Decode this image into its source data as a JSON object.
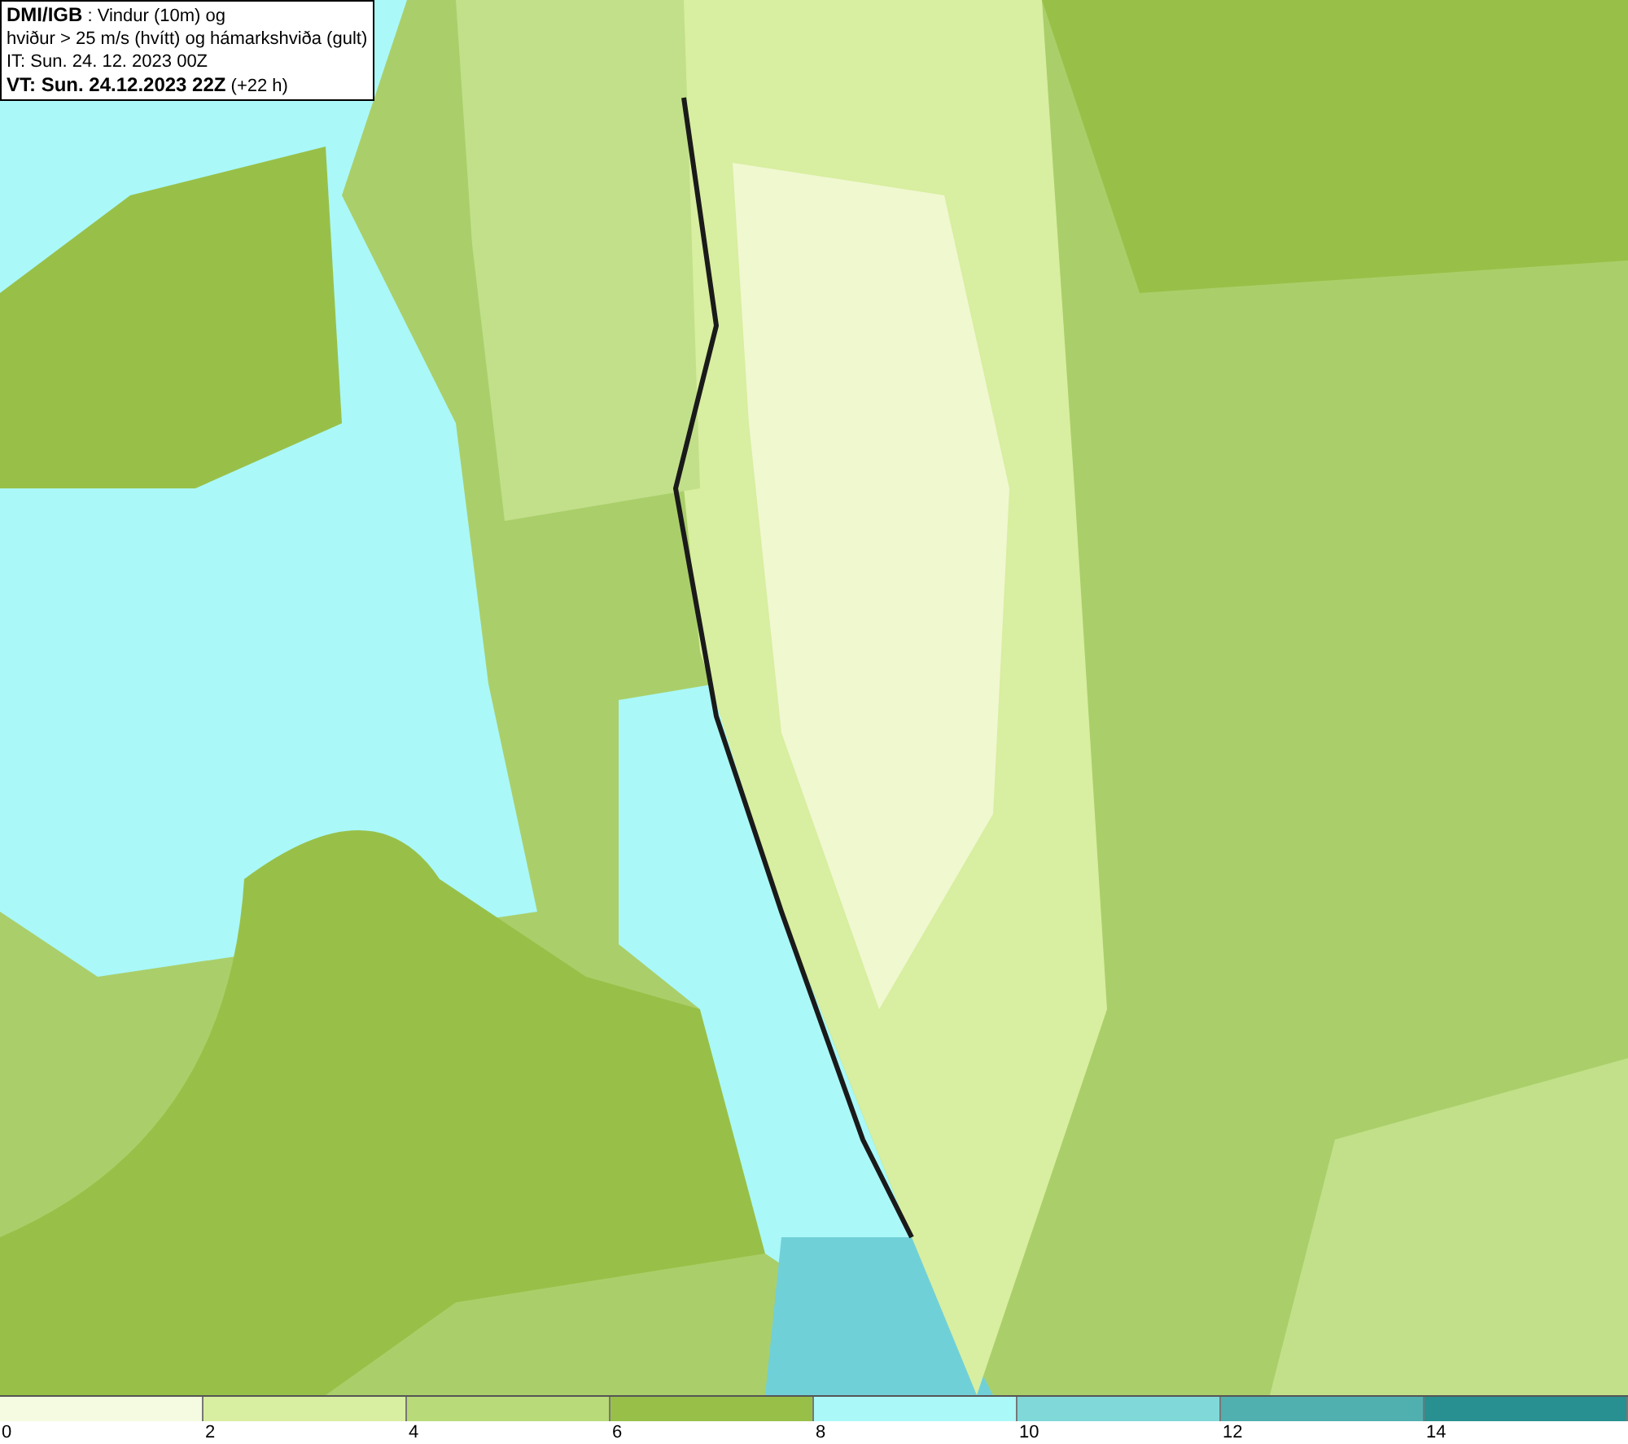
{
  "title_box": {
    "lines": [
      "**DMI/IGB** : Vindur (10m) og",
      "hviður > 25 m/s (hvítt) og hámarkshviða (gult)",
      "IT: Sun. 24. 12. 2023 00Z",
      "**VT: Sun. 24.12.2023 22Z** (+22 h)"
    ]
  },
  "legend": {
    "bins": [
      {
        "label": "0",
        "color": "#f5fbe0"
      },
      {
        "label": "2",
        "color": "#d8eea0"
      },
      {
        "label": "4",
        "color": "#b8da78"
      },
      {
        "label": "6",
        "color": "#98c048"
      },
      {
        "label": "8",
        "color": "#aaf8f8"
      },
      {
        "label": "10",
        "color": "#80d8d8"
      },
      {
        "label": "12",
        "color": "#50b0b0"
      },
      {
        "label": "14",
        "color": "#289090"
      }
    ]
  }
}
